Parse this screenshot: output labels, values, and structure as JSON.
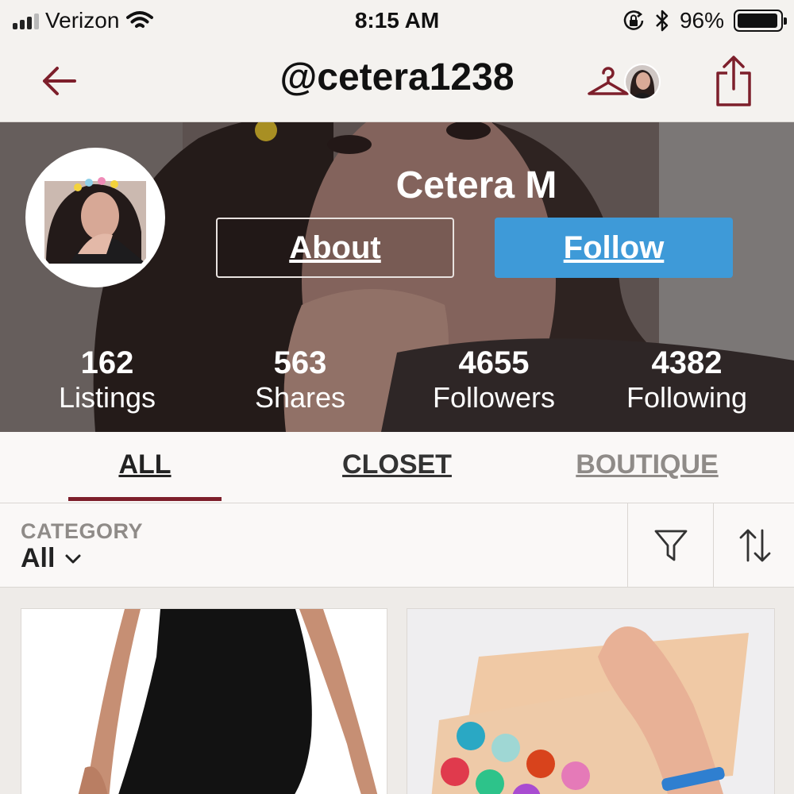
{
  "status_bar": {
    "carrier": "Verizon",
    "time": "8:15 AM",
    "battery": "96%",
    "battery_level": 0.96
  },
  "nav": {
    "title": "@cetera1238"
  },
  "profile": {
    "name": "Cetera M",
    "about_label": "About",
    "follow_label": "Follow",
    "stats": [
      {
        "value": "162",
        "label": "Listings"
      },
      {
        "value": "563",
        "label": "Shares"
      },
      {
        "value": "4655",
        "label": "Followers"
      },
      {
        "value": "4382",
        "label": "Following"
      }
    ]
  },
  "tabs": [
    {
      "label": "ALL",
      "active": true
    },
    {
      "label": "CLOSET",
      "active": false
    },
    {
      "label": "BOUTIQUE",
      "active": false
    }
  ],
  "filter": {
    "category_label": "CATEGORY",
    "category_value": "All"
  },
  "colors": {
    "accent": "#7d1f2b",
    "follow_button": "#3e9ad8",
    "muted_text": "#8f8b88"
  },
  "icons": {
    "back": "arrow-left-icon",
    "closet": "hanger-icon",
    "share": "share-icon",
    "filter": "funnel-icon",
    "sort": "sort-arrows-icon",
    "dropdown": "chevron-down-icon"
  }
}
